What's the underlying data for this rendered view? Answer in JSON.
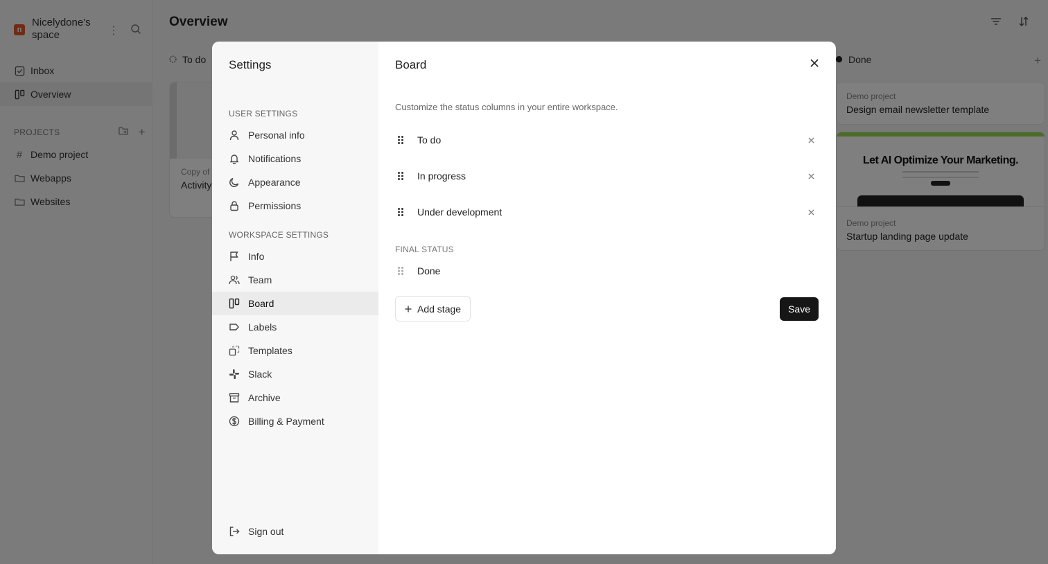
{
  "workspace": {
    "name": "Nicelydone's space",
    "logo_letter": "n"
  },
  "nav": {
    "inbox": "Inbox",
    "overview": "Overview"
  },
  "projects": {
    "header": "PROJECTS",
    "items": [
      {
        "label": "Demo project",
        "icon": "hash-icon"
      },
      {
        "label": "Webapps",
        "icon": "folder-icon"
      },
      {
        "label": "Websites",
        "icon": "folder-icon"
      }
    ]
  },
  "main": {
    "title": "Overview",
    "columns": {
      "todo": "To do",
      "done": "Done"
    },
    "cards": [
      {
        "meta": "Copy of l",
        "title": "Activity"
      },
      {
        "meta": "Demo project",
        "title": "Design email newsletter template"
      },
      {
        "meta": "Demo project",
        "title": "Startup landing page update",
        "hero_text": "Let AI Optimize Your Marketing."
      }
    ]
  },
  "settings": {
    "title": "Settings",
    "user_section": "USER SETTINGS",
    "user_items": [
      {
        "label": "Personal info",
        "icon": "user-icon"
      },
      {
        "label": "Notifications",
        "icon": "bell-icon"
      },
      {
        "label": "Appearance",
        "icon": "moon-icon"
      },
      {
        "label": "Permissions",
        "icon": "lock-icon"
      }
    ],
    "workspace_section": "WORKSPACE SETTINGS",
    "workspace_items": [
      {
        "label": "Info",
        "icon": "flag-icon"
      },
      {
        "label": "Team",
        "icon": "users-icon"
      },
      {
        "label": "Board",
        "icon": "board-icon",
        "active": true
      },
      {
        "label": "Labels",
        "icon": "tag-icon"
      },
      {
        "label": "Templates",
        "icon": "templates-icon"
      },
      {
        "label": "Slack",
        "icon": "slack-icon"
      },
      {
        "label": "Archive",
        "icon": "archive-icon"
      },
      {
        "label": "Billing & Payment",
        "icon": "dollar-icon"
      }
    ],
    "sign_out": "Sign out"
  },
  "board": {
    "title": "Board",
    "description": "Customize the status columns in your entire workspace.",
    "stages": [
      "To do",
      "In progress",
      "Under development"
    ],
    "final_label": "FINAL STATUS",
    "final_stage": "Done",
    "add_stage_label": "Add stage",
    "save_label": "Save"
  }
}
